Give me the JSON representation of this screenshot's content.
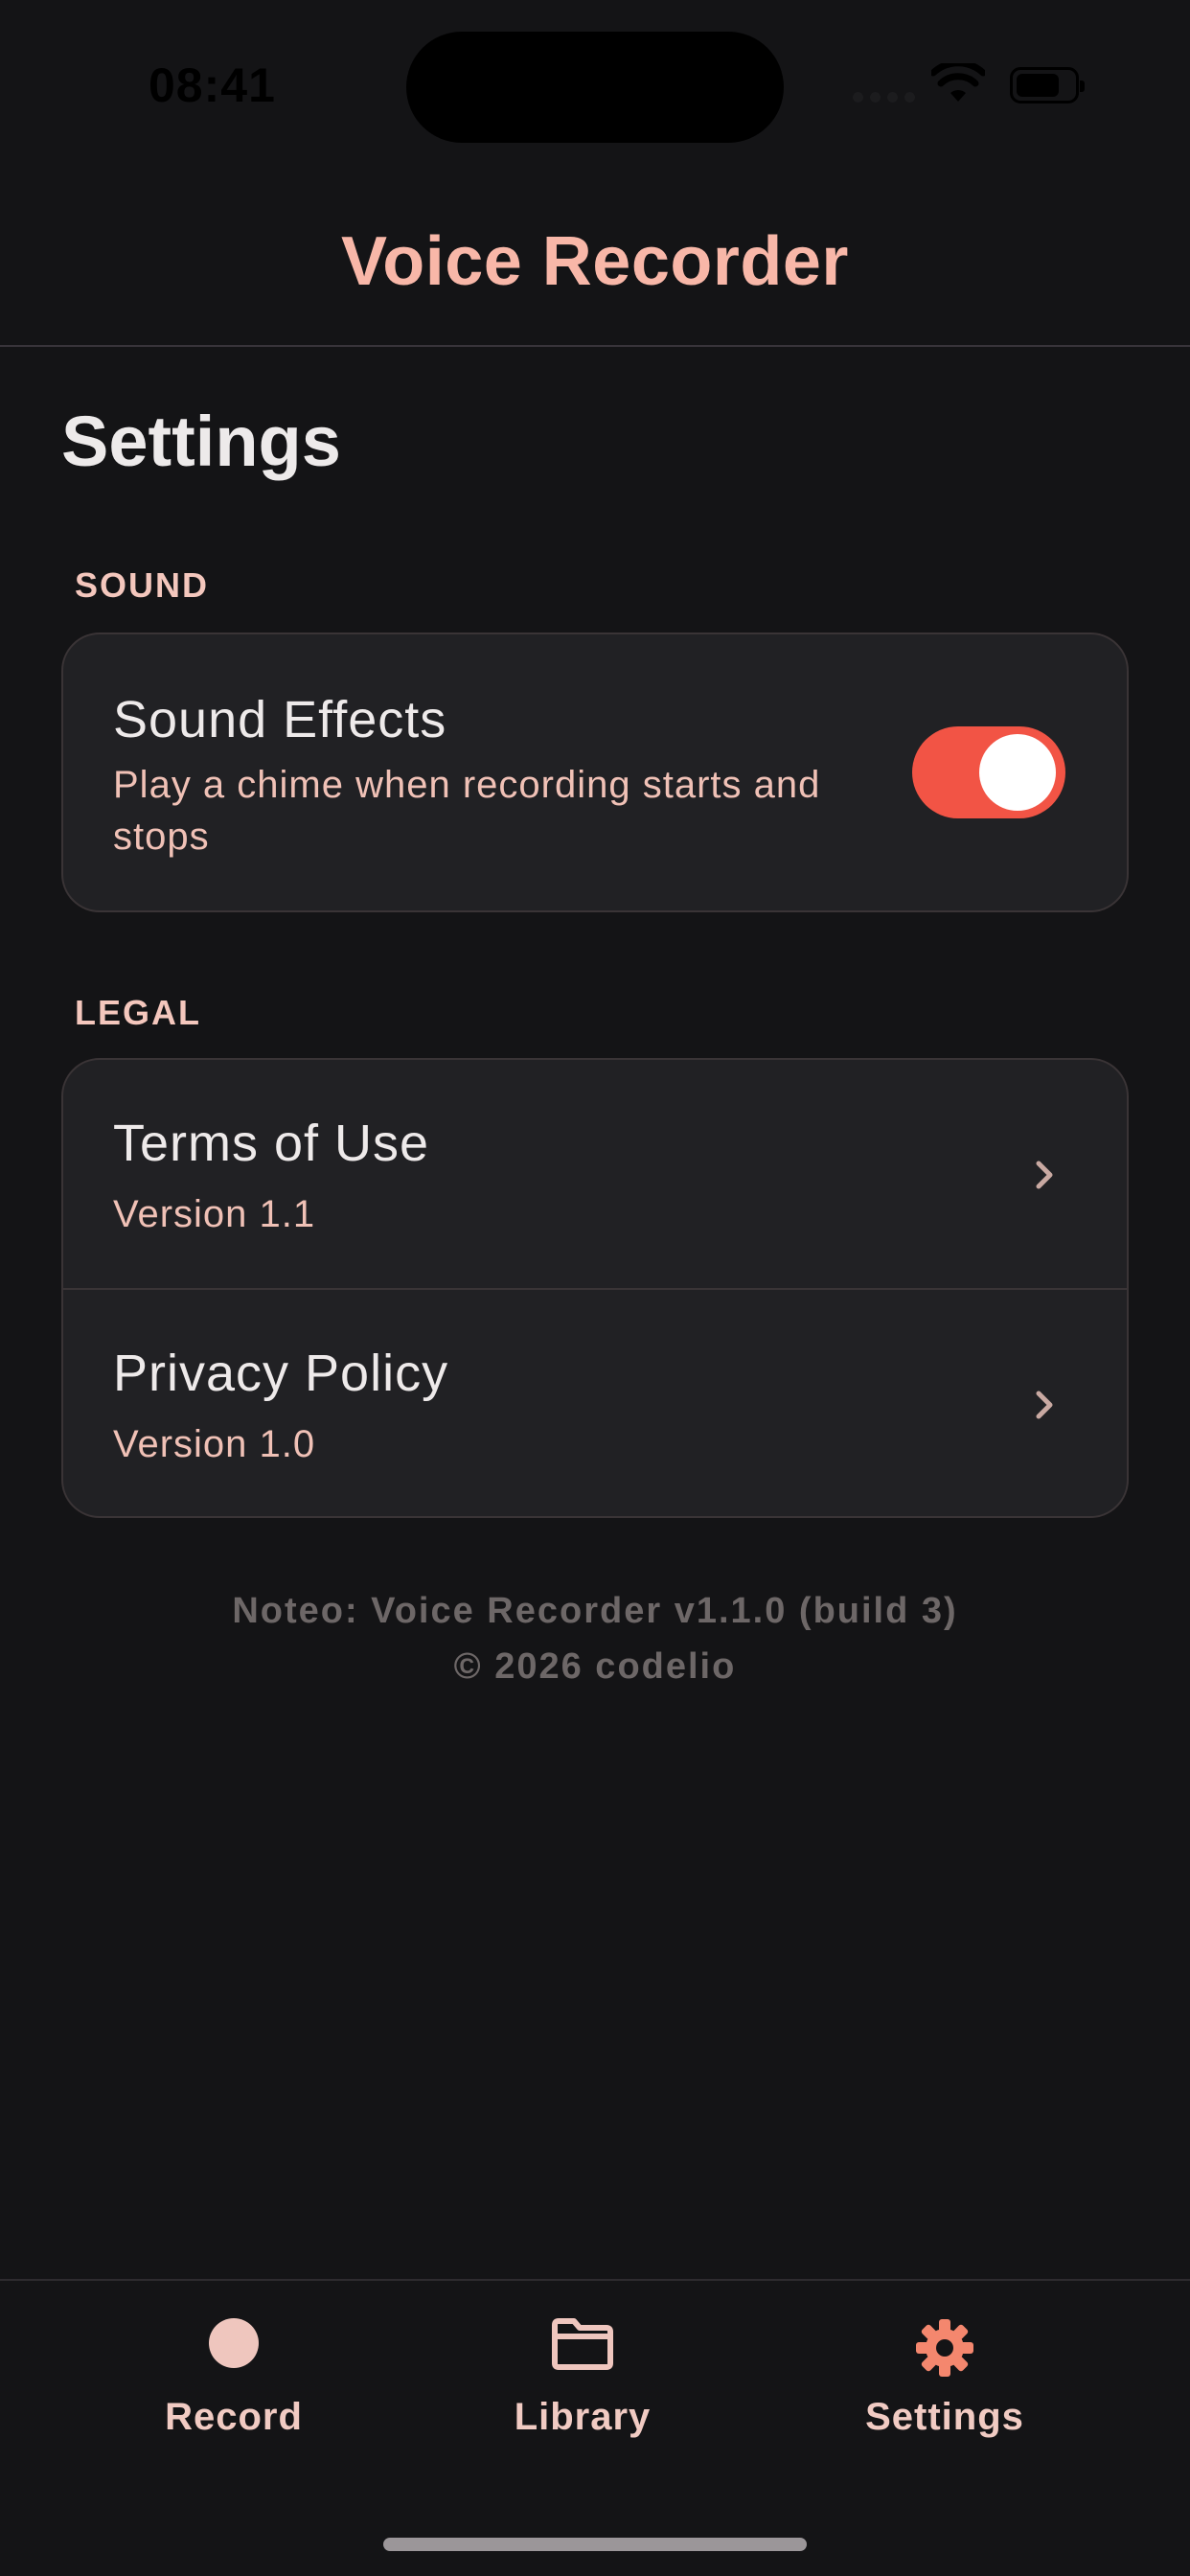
{
  "status_bar": {
    "time": "08:41"
  },
  "header": {
    "title": "Voice Recorder"
  },
  "page": {
    "title": "Settings"
  },
  "sections": {
    "sound": {
      "label": "SOUND",
      "sound_effects": {
        "title": "Sound Effects",
        "description_line1": "Play a chime when recording starts and",
        "description_line2": "stops",
        "enabled": true
      }
    },
    "legal": {
      "label": "LEGAL",
      "items": [
        {
          "title": "Terms of Use",
          "subtitle": "Version 1.1"
        },
        {
          "title": "Privacy Policy",
          "subtitle": "Version 1.0"
        }
      ]
    }
  },
  "footer": {
    "line1": "Noteo: Voice Recorder v1.1.0 (build 3)",
    "line2": "© 2026 codelio"
  },
  "tab_bar": {
    "tabs": [
      {
        "label": "Record",
        "icon": "record-dot-icon"
      },
      {
        "label": "Library",
        "icon": "folder-icon"
      },
      {
        "label": "Settings",
        "icon": "gear-icon",
        "active": true
      }
    ]
  },
  "colors": {
    "background": "#141416",
    "card": "#212124",
    "accent": "#F8B7A8",
    "toggle_on": "#F25445",
    "settings_icon_active": "#F4876E"
  }
}
